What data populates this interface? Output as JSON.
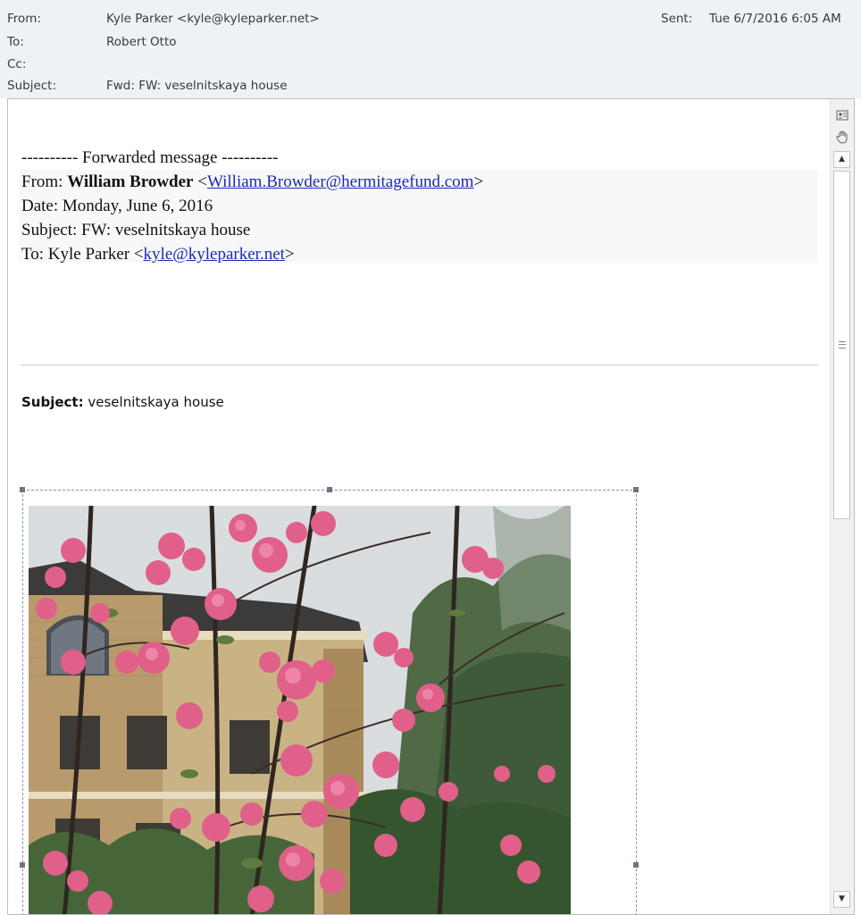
{
  "header": {
    "from_label": "From:",
    "from_value": "Kyle Parker <kyle@kyleparker.net>",
    "to_label": "To:",
    "to_value": "Robert Otto",
    "cc_label": "Cc:",
    "cc_value": "",
    "subject_label": "Subject:",
    "subject_value": "Fwd: FW: veselnitskaya house",
    "sent_label": "Sent:",
    "sent_value": "Tue 6/7/2016 6:05 AM"
  },
  "forwarded": {
    "banner": "---------- Forwarded message ----------",
    "from_label": "From: ",
    "from_name": "William Browder",
    "from_open": " <",
    "from_email": "William.Browder@hermitagefund.com",
    "from_close": ">",
    "date_line": "Date: Monday, June 6, 2016",
    "subject_line": "Subject: FW: veselnitskaya house",
    "to_label": "To: Kyle Parker <",
    "to_email": "kyle@kyleparker.net",
    "to_close": ">"
  },
  "inner": {
    "subject_label": "Subject:",
    "subject_value": " veselnitskaya house"
  },
  "scrollbar": {
    "icon_top": "contact-card-icon",
    "icon_second": "hand-icon",
    "up_arrow": "▲",
    "down_arrow": "▼"
  },
  "colors": {
    "header_bg": "#eef2f7",
    "link": "#1f2bb0",
    "blossom": "#e0608a"
  }
}
